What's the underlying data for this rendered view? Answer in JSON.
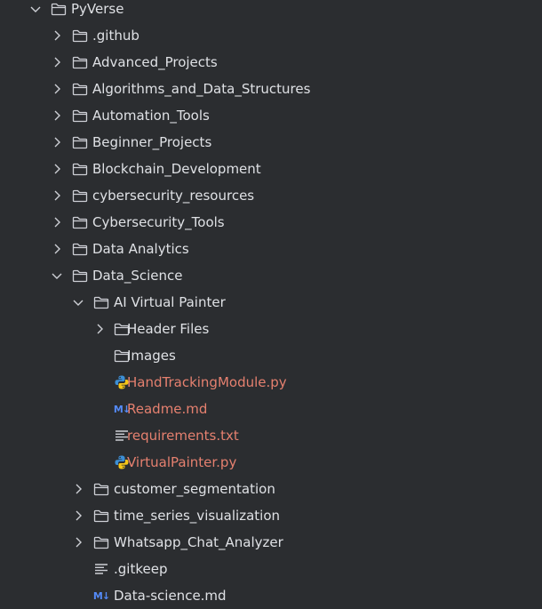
{
  "colors": {
    "background": "#2b2d30",
    "text": "#dfe1e5",
    "modified": "#e5806f",
    "icon": "#ced0d6",
    "markdown": "#548af7"
  },
  "tree": [
    {
      "level": 0,
      "type": "folder",
      "expanded": true,
      "name": "PyVerse",
      "modified": false
    },
    {
      "level": 1,
      "type": "folder",
      "expanded": false,
      "name": ".github",
      "modified": false
    },
    {
      "level": 1,
      "type": "folder",
      "expanded": false,
      "name": "Advanced_Projects",
      "modified": false
    },
    {
      "level": 1,
      "type": "folder",
      "expanded": false,
      "name": "Algorithms_and_Data_Structures",
      "modified": false
    },
    {
      "level": 1,
      "type": "folder",
      "expanded": false,
      "name": "Automation_Tools",
      "modified": false
    },
    {
      "level": 1,
      "type": "folder",
      "expanded": false,
      "name": "Beginner_Projects",
      "modified": false
    },
    {
      "level": 1,
      "type": "folder",
      "expanded": false,
      "name": "Blockchain_Development",
      "modified": false
    },
    {
      "level": 1,
      "type": "folder",
      "expanded": false,
      "name": "cybersecurity_resources",
      "modified": false
    },
    {
      "level": 1,
      "type": "folder",
      "expanded": false,
      "name": "Cybersecurity_Tools",
      "modified": false
    },
    {
      "level": 1,
      "type": "folder",
      "expanded": false,
      "name": "Data Analytics",
      "modified": false
    },
    {
      "level": 1,
      "type": "folder",
      "expanded": true,
      "name": "Data_Science",
      "modified": false
    },
    {
      "level": 2,
      "type": "folder",
      "expanded": true,
      "name": "AI Virtual Painter",
      "modified": false
    },
    {
      "level": 3,
      "type": "folder",
      "expanded": false,
      "name": "Header Files",
      "modified": false
    },
    {
      "level": 3,
      "type": "folder",
      "expanded": null,
      "name": "Images",
      "modified": false
    },
    {
      "level": 3,
      "type": "python",
      "expanded": null,
      "name": "HandTrackingModule.py",
      "modified": true
    },
    {
      "level": 3,
      "type": "markdown",
      "expanded": null,
      "name": "Readme.md",
      "modified": true
    },
    {
      "level": 3,
      "type": "text",
      "expanded": null,
      "name": "requirements.txt",
      "modified": true
    },
    {
      "level": 3,
      "type": "python",
      "expanded": null,
      "name": "VirtualPainter.py",
      "modified": true
    },
    {
      "level": 2,
      "type": "folder",
      "expanded": false,
      "name": "customer_segmentation",
      "modified": false
    },
    {
      "level": 2,
      "type": "folder",
      "expanded": false,
      "name": "time_series_visualization",
      "modified": false
    },
    {
      "level": 2,
      "type": "folder",
      "expanded": false,
      "name": "Whatsapp_Chat_Analyzer",
      "modified": false
    },
    {
      "level": 2,
      "type": "text",
      "expanded": null,
      "name": ".gitkeep",
      "modified": false
    },
    {
      "level": 2,
      "type": "markdown",
      "expanded": null,
      "name": "Data-science.md",
      "modified": false
    }
  ]
}
